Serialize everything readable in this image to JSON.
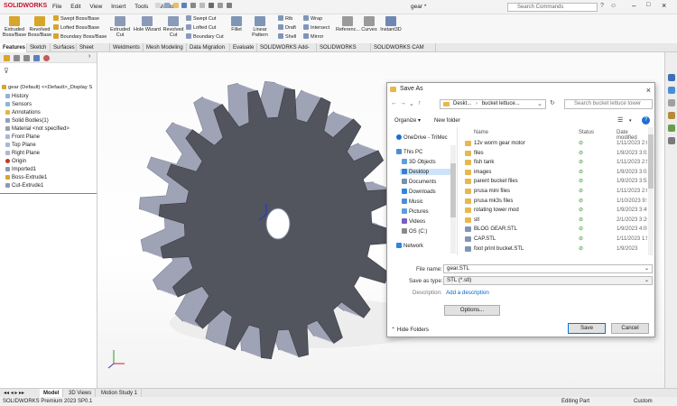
{
  "app": {
    "logo": "SOLIDWORKS",
    "document_title": "gear *",
    "search_placeholder": "Search Commands",
    "menu": [
      "File",
      "Edit",
      "View",
      "Insert",
      "Tools",
      "Window"
    ]
  },
  "ribbon": {
    "extruded_boss": "Extruded Boss/Base",
    "revolved_boss": "Revolved Boss/Base",
    "swept_boss": "Swept Boss/Base",
    "lofted_boss": "Lofted Boss/Base",
    "boundary_boss": "Boundary Boss/Base",
    "extruded_cut": "Extruded Cut",
    "hole_wizard": "Hole Wizard",
    "revolved_cut": "Revolved Cut",
    "swept_cut": "Swept Cut",
    "lofted_cut": "Lofted Cut",
    "boundary_cut": "Boundary Cut",
    "fillet": "Fillet",
    "linear_pattern": "Linear Pattern",
    "rib": "Rib",
    "draft": "Draft",
    "shell": "Shell",
    "wrap": "Wrap",
    "intersect": "Intersect",
    "mirror": "Mirror",
    "reference": "Referenc...",
    "curves": "Curves",
    "instant3d": "Instant3D"
  },
  "command_tabs": [
    "Features",
    "Sketch",
    "Surfaces",
    "Sheet Metal",
    "Weldments",
    "Mesh Modeling",
    "Data Migration",
    "Evaluate",
    "SOLIDWORKS Add-Ins",
    "SOLIDWORKS CAM",
    "SOLIDWORKS CAM TBM"
  ],
  "tree": {
    "root": "gear (Default) <<Default>_Display S",
    "items": [
      "History",
      "Sensors",
      "Annotations",
      "Solid Bodies(1)",
      "Material <not specified>",
      "Front Plane",
      "Top Plane",
      "Right Plane",
      "Origin",
      "Imported1",
      "Boss-Extrude1",
      "Cut-Extrude1"
    ]
  },
  "bottom_tabs": [
    "Model",
    "3D Views",
    "Motion Study 1"
  ],
  "status": {
    "left": "SOLIDWORKS Premium 2023 SP0.1",
    "mode": "Editing Part",
    "units": "Custom"
  },
  "dialog": {
    "title": "Save As",
    "breadcrumb": [
      "Deskt...",
      "bucket lettuce..."
    ],
    "search_placeholder": "Search bucket lettuce tower",
    "organize": "Organize",
    "new_folder": "New folder",
    "nav": [
      "OneDrive - TriMec",
      "This PC",
      "3D Objects",
      "Desktop",
      "Documents",
      "Downloads",
      "Music",
      "Pictures",
      "Videos",
      "OS (C:)",
      "Network"
    ],
    "columns": {
      "name": "Name",
      "status": "Status",
      "date": "Date modified"
    },
    "files": [
      {
        "name": "12v worm gear motor",
        "date": "1/11/2023 2:0",
        "type": "folder"
      },
      {
        "name": "files",
        "date": "1/9/2023 3:02",
        "type": "folder"
      },
      {
        "name": "fish tank",
        "date": "1/11/2023 2:5",
        "type": "folder"
      },
      {
        "name": "images",
        "date": "1/9/2023 3:02",
        "type": "folder"
      },
      {
        "name": "parent bucket files",
        "date": "1/9/2023 3:53",
        "type": "folder"
      },
      {
        "name": "prusa mini files",
        "date": "1/11/2023 2:0",
        "type": "folder"
      },
      {
        "name": "prusa mk3s files",
        "date": "1/10/2023 9:5",
        "type": "folder"
      },
      {
        "name": "rotating tower mod",
        "date": "1/9/2023 3:45",
        "type": "folder"
      },
      {
        "name": "stl",
        "date": "2/1/2023 3:26",
        "type": "folder"
      },
      {
        "name": "BLOG GEAR.STL",
        "date": "1/9/2023 4:08",
        "type": "file"
      },
      {
        "name": "CAP.STL",
        "date": "1/11/2023 1:5",
        "type": "file"
      },
      {
        "name": "foot print bucket.STL",
        "date": "1/9/2023",
        "type": "file"
      }
    ],
    "file_name_label": "File name:",
    "file_name_value": "gear.STL",
    "save_type_label": "Save as type:",
    "save_type_value": "STL (*.stl)",
    "description_label": "Description:",
    "description_link": "Add a description",
    "options_button": "Options...",
    "hide_folders": "Hide Folders",
    "save_button": "Save",
    "cancel_button": "Cancel"
  },
  "colors": {
    "accent": "#0078d7",
    "brand": "#c8102e",
    "gear_face": "#52545e",
    "gear_side": "#9fa3b6",
    "folder": "#e8b84a"
  }
}
